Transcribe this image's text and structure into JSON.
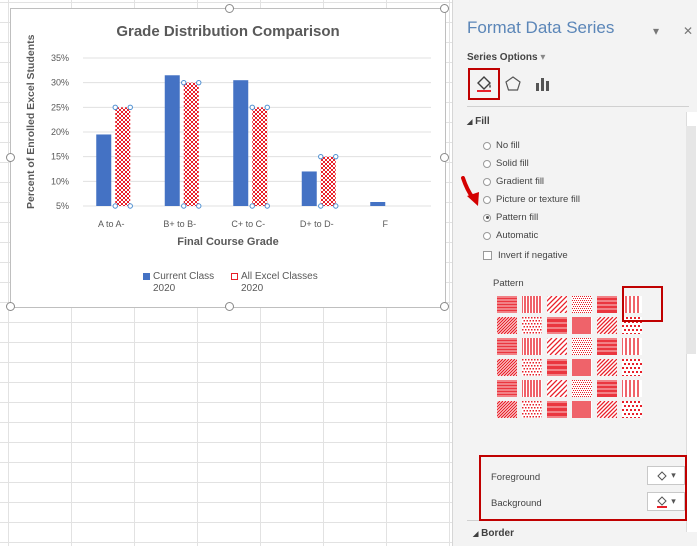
{
  "chart_data": {
    "type": "bar",
    "title": "Grade Distribution Comparison",
    "xlabel": "Final Course Grade",
    "ylabel": "Percent of Enrolled Excel Students",
    "categories": [
      "A to A-",
      "B+ to B-",
      "C+ to C-",
      "D+ to D-",
      "F"
    ],
    "series": [
      {
        "name": "Current  Class 2020",
        "values": [
          19.5,
          31.5,
          30.5,
          12,
          1
        ]
      },
      {
        "name": "All Excel Classes 2020",
        "values": [
          25,
          30,
          25,
          15,
          0
        ]
      }
    ],
    "yticks": [
      "5%",
      "10%",
      "15%",
      "20%",
      "25%",
      "30%",
      "35%"
    ],
    "ylim": [
      5,
      35
    ],
    "colors": {
      "current": "#4472c4",
      "all": "#e8202a"
    },
    "legend_position": "bottom"
  },
  "chart_legend": {
    "current_line1": "Current  Class",
    "current_line2": "2020",
    "all_line1": "All Excel Classes",
    "all_line2": "2020"
  },
  "panel": {
    "title": "Format Data Series",
    "series_options_label": "Series Options",
    "fill_section": "Fill",
    "fill_options": [
      "No fill",
      "Solid fill",
      "Gradient fill",
      "Picture or texture fill",
      "Pattern fill",
      "Automatic"
    ],
    "selected_fill": "Pattern fill",
    "invert_label": "Invert if negative",
    "pattern_label": "Pattern",
    "foreground_label": "Foreground",
    "background_label": "Background",
    "border_section": "Border",
    "icons": [
      "fill-line-icon",
      "effects-pentagon-icon",
      "series-options-chart-icon"
    ]
  }
}
